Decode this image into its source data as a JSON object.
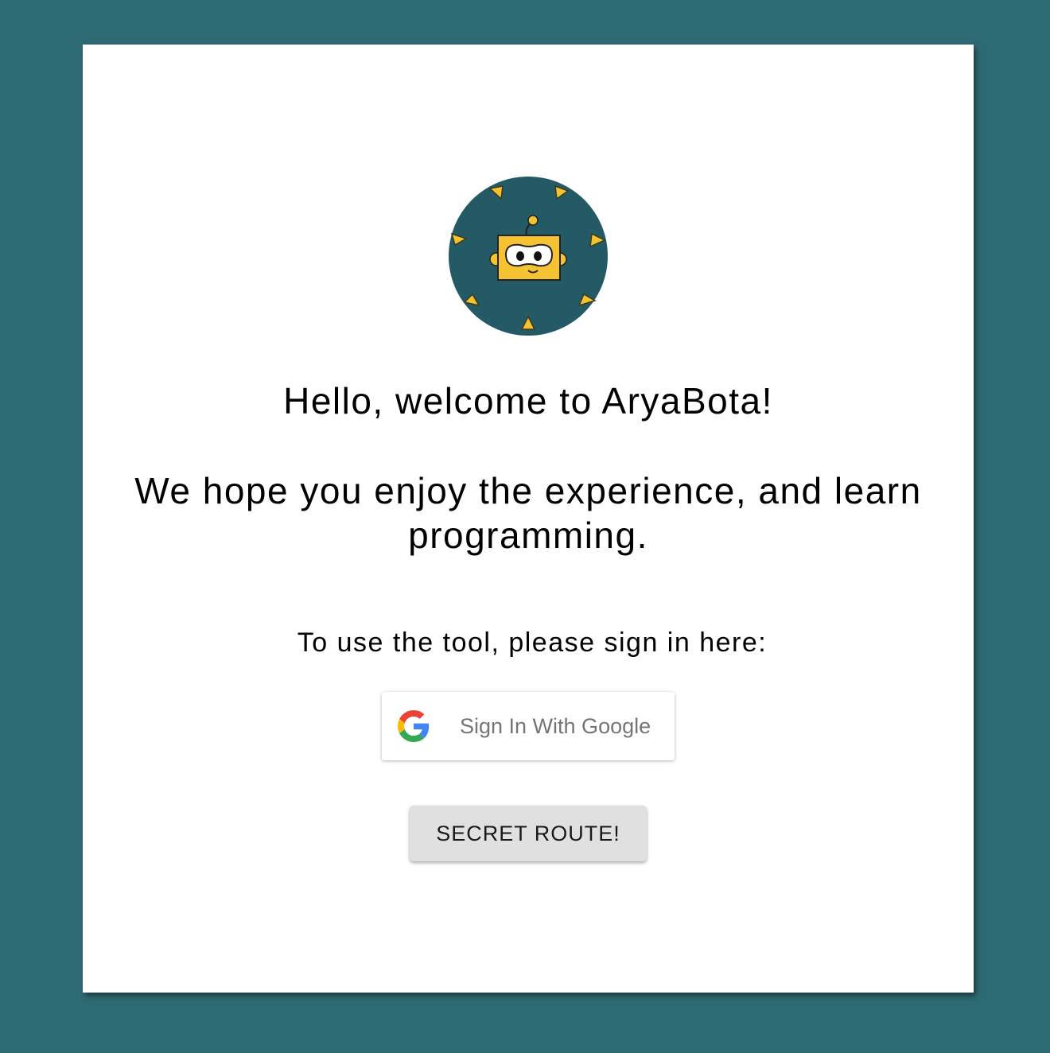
{
  "logo": {
    "icon": "aryabota-robot-logo-icon",
    "circle_color": "#245a66",
    "accent_color": "#f5c231"
  },
  "welcome": {
    "title": "Hello, welcome to AryaBota!",
    "subtitle": "We hope you enjoy the experience, and learn programming."
  },
  "signin": {
    "prompt": "To use the tool, please sign in here:",
    "google_button_label": "Sign In With Google",
    "google_icon": "google-g-icon"
  },
  "secret": {
    "button_label": "SECRET ROUTE!"
  },
  "colors": {
    "background": "#2e6a73",
    "card": "#ffffff",
    "secret_button": "#e0e0e0"
  }
}
